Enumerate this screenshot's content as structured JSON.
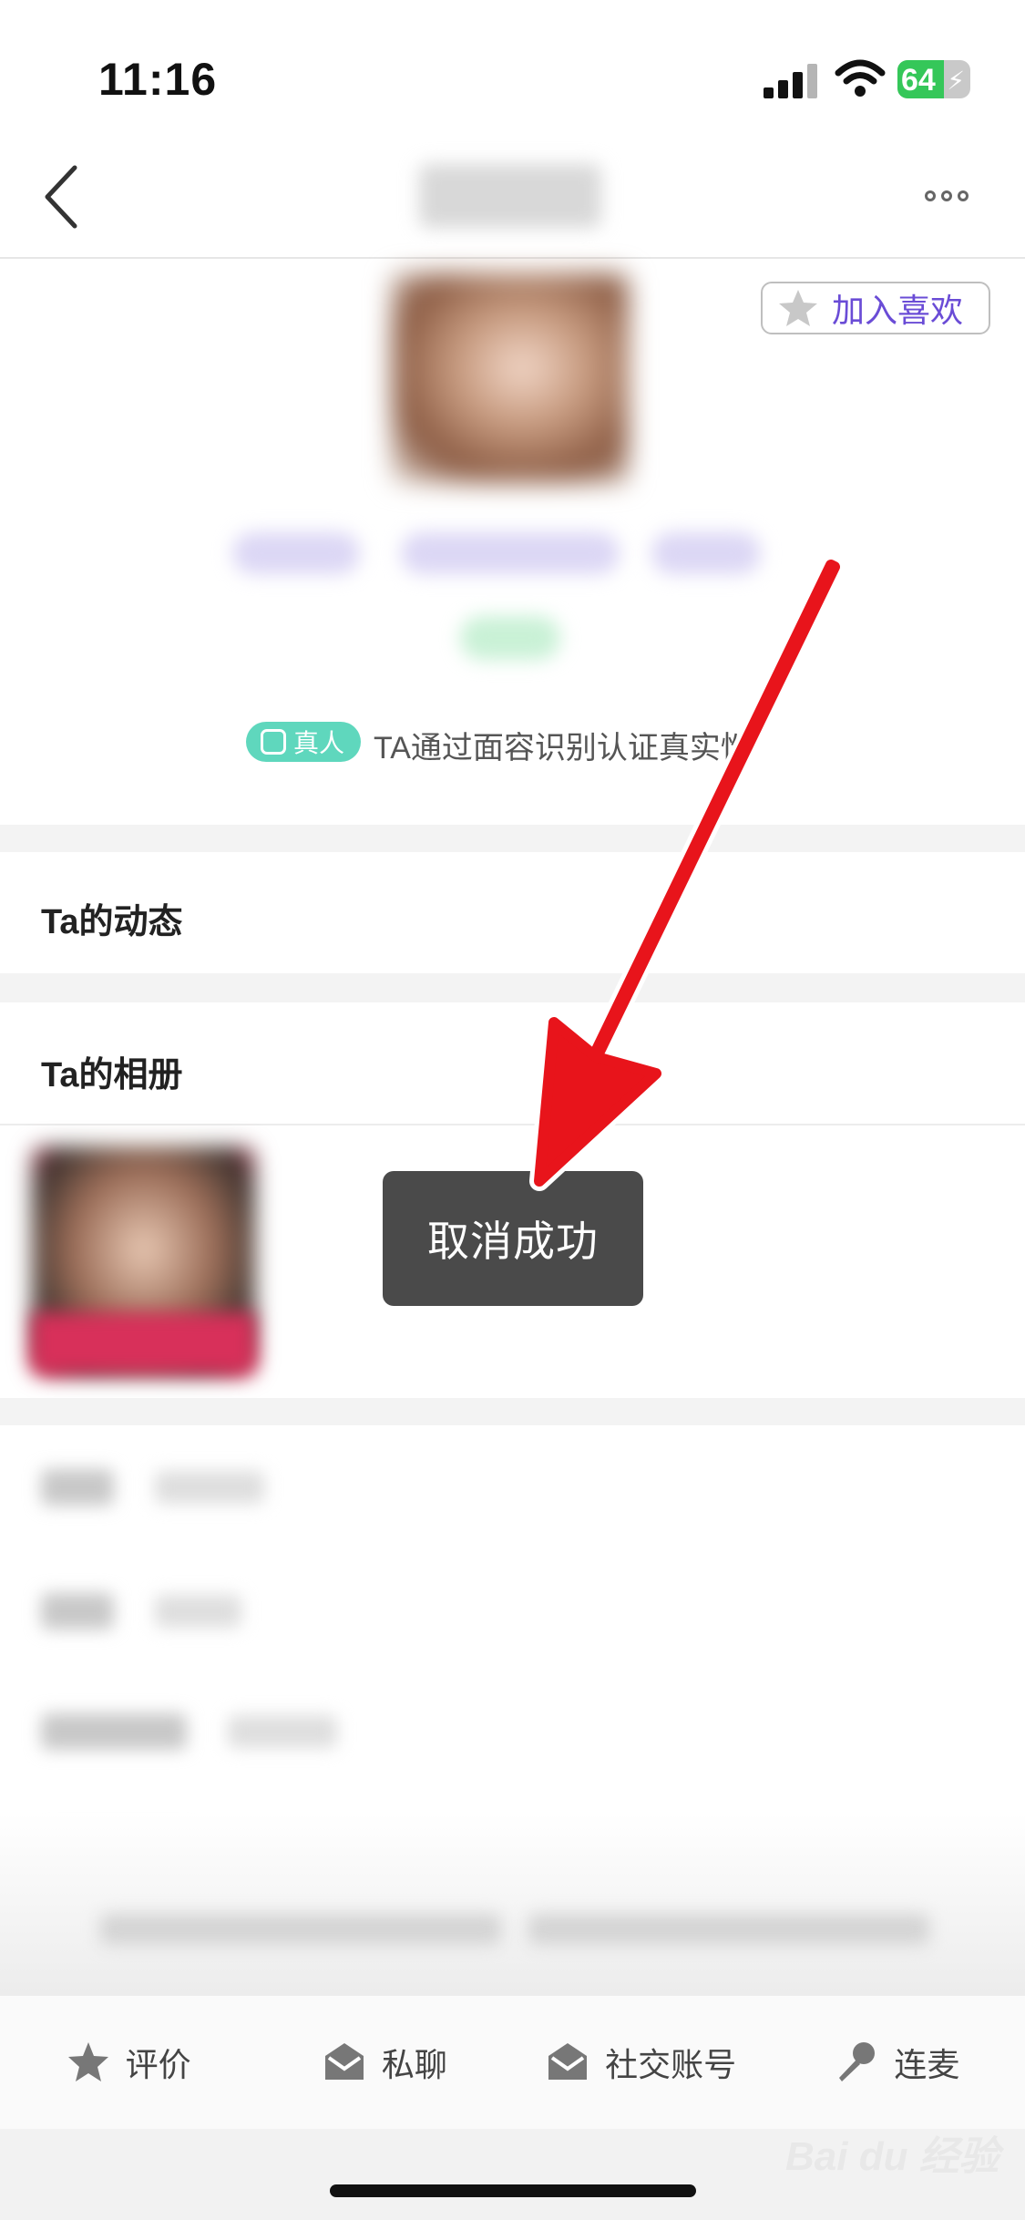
{
  "status_bar": {
    "time": "11:16",
    "battery": "64",
    "battery_level": 0.64
  },
  "header": {
    "back_icon": "chevron-left-icon",
    "more_icon": "ellipsis-icon"
  },
  "profile": {
    "favorite_label": "加入喜欢",
    "favorite_icon": "star-icon",
    "real_badge": "真人",
    "verify_text": "TA通过面容识别认证真实性"
  },
  "sections": {
    "moments_title": "Ta的动态",
    "album_title": "Ta的相册"
  },
  "toast": {
    "message": "取消成功"
  },
  "bottom_bar": {
    "items": [
      {
        "label": "评价",
        "icon": "star-icon"
      },
      {
        "label": "私聊",
        "icon": "mail-icon"
      },
      {
        "label": "社交账号",
        "icon": "mail-icon"
      },
      {
        "label": "连麦",
        "icon": "microphone-icon"
      }
    ]
  },
  "watermark": {
    "text": "Bai du 经验"
  },
  "colors": {
    "accent": "#6a4cd6",
    "badge": "#5fd7bd",
    "arrow": "#e8141b",
    "toast_bg": "#4a4a4a"
  }
}
